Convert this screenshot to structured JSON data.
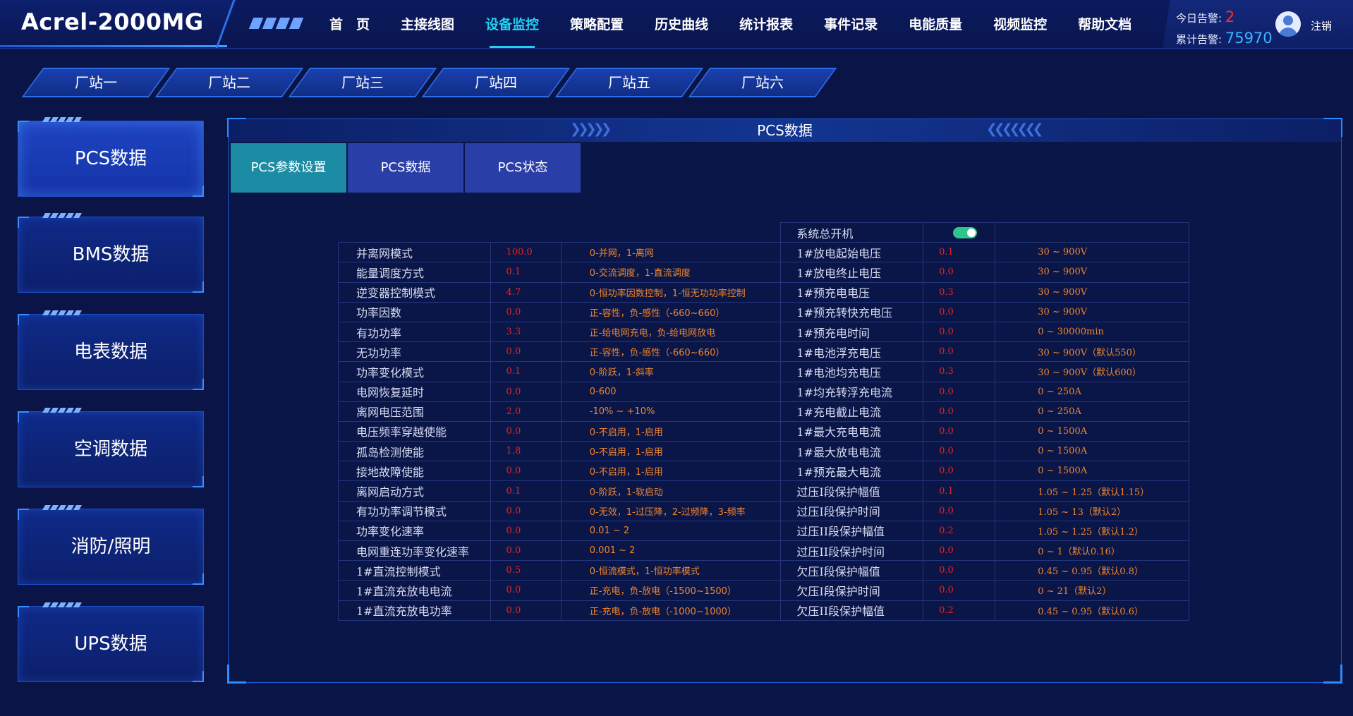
{
  "app": {
    "title": "Acrel-2000MG"
  },
  "nav": {
    "items": [
      {
        "label": "首　页",
        "active": false
      },
      {
        "label": "主接线图",
        "active": false
      },
      {
        "label": "设备监控",
        "active": true
      },
      {
        "label": "策略配置",
        "active": false
      },
      {
        "label": "历史曲线",
        "active": false
      },
      {
        "label": "统计报表",
        "active": false
      },
      {
        "label": "事件记录",
        "active": false
      },
      {
        "label": "电能质量",
        "active": false
      },
      {
        "label": "视频监控",
        "active": false
      },
      {
        "label": "帮助文档",
        "active": false
      }
    ]
  },
  "alarms": {
    "today_label": "今日告警:",
    "today_value": "2",
    "total_label": "累计告警:",
    "total_value": "75970"
  },
  "user": {
    "logout_label": "注销"
  },
  "stations": [
    "厂站一",
    "厂站二",
    "厂站三",
    "厂站四",
    "厂站五",
    "厂站六"
  ],
  "side_menu": [
    {
      "label": "PCS数据",
      "active": true
    },
    {
      "label": "BMS数据",
      "active": false
    },
    {
      "label": "电表数据",
      "active": false
    },
    {
      "label": "空调数据",
      "active": false
    },
    {
      "label": "消防/照明",
      "active": false
    },
    {
      "label": "UPS数据",
      "active": false
    }
  ],
  "panel": {
    "title": "PCS数据",
    "tabs": [
      {
        "label": "PCS参数设置",
        "active": true
      },
      {
        "label": "PCS数据",
        "active": false
      },
      {
        "label": "PCS状态",
        "active": false
      }
    ]
  },
  "system_switch": {
    "label": "系统总开机",
    "on": true
  },
  "params": [
    {
      "name": "并离网模式",
      "value": "100.0",
      "desc": "0-并网，1-离网",
      "name2": "1#放电起始电压",
      "value2": "0.1",
      "range2": "30 ~ 900V"
    },
    {
      "name": "能量调度方式",
      "value": "0.1",
      "desc": "0-交流调度，1-直流调度",
      "name2": "1#放电终止电压",
      "value2": "0.0",
      "range2": "30 ~ 900V"
    },
    {
      "name": "逆变器控制模式",
      "value": "4.7",
      "desc": "0-恒功率因数控制，1-恒无功功率控制",
      "name2": "1#预充电电压",
      "value2": "0.3",
      "range2": "30 ~ 900V"
    },
    {
      "name": "功率因数",
      "value": "0.0",
      "desc": "正-容性，负-感性（-660~660）",
      "name2": "1#预充转快充电压",
      "value2": "0.0",
      "range2": "30 ~ 900V"
    },
    {
      "name": "有功功率",
      "value": "3.3",
      "desc": "正-给电网充电，负-给电网放电",
      "name2": "1#预充电时间",
      "value2": "0.0",
      "range2": "0 ~ 30000min"
    },
    {
      "name": "无功功率",
      "value": "0.0",
      "desc": "正-容性，负-感性（-660~660）",
      "name2": "1#电池浮充电压",
      "value2": "0.0",
      "range2": "30 ~ 900V（默认550）"
    },
    {
      "name": "功率变化模式",
      "value": "0.1",
      "desc": "0-阶跃，1-斜率",
      "name2": "1#电池均充电压",
      "value2": "0.3",
      "range2": "30 ~ 900V（默认600）"
    },
    {
      "name": "电网恢复延时",
      "value": "0.0",
      "desc": "0-600",
      "name2": "1#均充转浮充电流",
      "value2": "0.0",
      "range2": "0 ~ 250A"
    },
    {
      "name": "离网电压范围",
      "value": "2.0",
      "desc": "-10% ~ +10%",
      "name2": "1#充电截止电流",
      "value2": "0.0",
      "range2": "0 ~ 250A"
    },
    {
      "name": "电压频率穿越使能",
      "value": "0.0",
      "desc": "0-不启用，1-启用",
      "name2": "1#最大充电电流",
      "value2": "0.0",
      "range2": "0 ~ 1500A"
    },
    {
      "name": "孤岛检测使能",
      "value": "1.8",
      "desc": "0-不启用，1-启用",
      "name2": "1#最大放电电流",
      "value2": "0.0",
      "range2": "0 ~ 1500A"
    },
    {
      "name": "接地故障使能",
      "value": "0.0",
      "desc": "0-不启用，1-启用",
      "name2": "1#预充最大电流",
      "value2": "0.0",
      "range2": "0 ~ 1500A"
    },
    {
      "name": "离网启动方式",
      "value": "0.1",
      "desc": "0-阶跃，1-软启动",
      "name2": "过压I段保护幅值",
      "value2": "0.1",
      "range2": "1.05 ~ 1.25（默认1.15）"
    },
    {
      "name": "有功功率调节模式",
      "value": "0.0",
      "desc": "0-无效，1-过压降，2-过频降，3-频率",
      "name2": "过压I段保护时间",
      "value2": "0.0",
      "range2": "1.05 ~ 13（默认2）"
    },
    {
      "name": "功率变化速率",
      "value": "0.0",
      "desc": "0.01 ~ 2",
      "name2": "过压II段保护幅值",
      "value2": "0.2",
      "range2": "1.05 ~ 1.25（默认1.2）"
    },
    {
      "name": "电网重连功率变化速率",
      "value": "0.0",
      "desc": "0.001 ~ 2",
      "name2": "过压II段保护时间",
      "value2": "0.0",
      "range2": "0 ~ 1（默认0.16）"
    },
    {
      "name": "1#直流控制模式",
      "value": "0.5",
      "desc": "0-恒流模式，1-恒功率模式",
      "name2": "欠压I段保护幅值",
      "value2": "0.0",
      "range2": "0.45 ~ 0.95（默认0.8）"
    },
    {
      "name": "1#直流充放电电流",
      "value": "0.0",
      "desc": "正-充电，负-放电（-1500~1500）",
      "name2": "欠压I段保护时间",
      "value2": "0.0",
      "range2": "0 ~ 21（默认2）"
    },
    {
      "name": "1#直流充放电功率",
      "value": "0.0",
      "desc": "正-充电，负-放电（-1000~1000）",
      "name2": "欠压II段保护幅值",
      "value2": "0.2",
      "range2": "0.45 ~ 0.95（默认0.6）"
    }
  ]
}
